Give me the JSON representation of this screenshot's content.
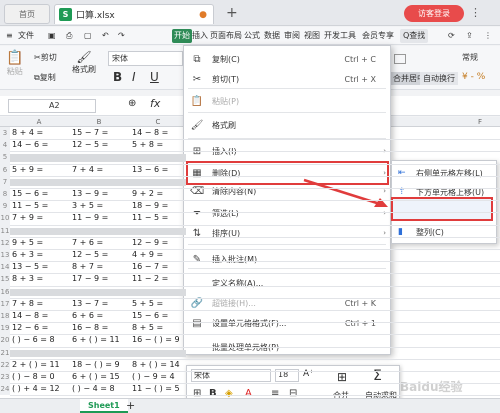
{
  "tabs": {
    "home": "首页",
    "file": "口算.xlsx",
    "file_badge": "S",
    "add": "+"
  },
  "login": "访客登录",
  "menu": {
    "file": "文件",
    "start": "开始",
    "items": [
      "插入",
      "页面布局",
      "公式",
      "数据",
      "审阅",
      "视图",
      "开发工具",
      "会员专享"
    ],
    "search": "Q查找"
  },
  "toolbar": {
    "cut": "剪切",
    "copy": "复制",
    "paste": "粘贴",
    "format_painter": "格式刷",
    "font": "宋体",
    "merge": "合并居中",
    "wrap": "自动换行",
    "normal": "常规"
  },
  "formula": {
    "namebox": "A2",
    "fx": "fx"
  },
  "columns": [
    "A",
    "B",
    "C",
    "F"
  ],
  "rows": [
    {
      "n": "3",
      "a": "8 + 4 =",
      "b": "15 − 7 =",
      "c": "14 − 8 ="
    },
    {
      "n": "4",
      "a": "14 − 6 =",
      "b": "12 − 5 =",
      "c": "5 + 8 ="
    },
    {
      "n": "5",
      "a": "",
      "b": "",
      "c": ""
    },
    {
      "n": "6",
      "a": "5 + 9 =",
      "b": "7 + 4 =",
      "c": "13 − 6 ="
    },
    {
      "n": "7",
      "a": "",
      "b": "",
      "c": ""
    },
    {
      "n": "8",
      "a": "15 − 6 =",
      "b": "13 − 9 =",
      "c": "9 + 2 ="
    },
    {
      "n": "9",
      "a": "11 − 5 =",
      "b": "3 + 5 =",
      "c": "18 − 9 ="
    },
    {
      "n": "10",
      "a": "7 + 9 =",
      "b": "11 − 9 =",
      "c": "11 − 5 ="
    },
    {
      "n": "11",
      "a": "",
      "b": "",
      "c": ""
    },
    {
      "n": "12",
      "a": "9 + 5 =",
      "b": "7 + 6 =",
      "c": "12 − 9 ="
    },
    {
      "n": "13",
      "a": "6 + 3 =",
      "b": "12 − 5 =",
      "c": "4 + 9 ="
    },
    {
      "n": "14",
      "a": "13 − 5 =",
      "b": "8 + 7 =",
      "c": "16 − 7 ="
    },
    {
      "n": "15",
      "a": "8 + 3 =",
      "b": "17 − 9 =",
      "c": "11 − 2 ="
    },
    {
      "n": "16",
      "a": "",
      "b": "",
      "c": ""
    },
    {
      "n": "17",
      "a": "7 + 8 =",
      "b": "13 − 7 =",
      "c": "5 + 5 ="
    },
    {
      "n": "18",
      "a": "14 − 8 =",
      "b": "6 + 6 =",
      "c": "15 − 6 ="
    },
    {
      "n": "19",
      "a": "12 − 6 =",
      "b": "16 − 8 =",
      "c": "8 + 5 ="
    },
    {
      "n": "20",
      "a": "(  ) − 6 = 8",
      "b": "6 + (  ) = 11",
      "c": "16 − (  ) = 9"
    },
    {
      "n": "21",
      "a": "",
      "b": "",
      "c": ""
    },
    {
      "n": "22",
      "a": "2 + (  ) = 11",
      "b": "18 − (  ) = 9",
      "c": "8 + (  ) = 14"
    },
    {
      "n": "23",
      "a": "(  ) − 8 = 0",
      "b": "6 + (  ) = 15",
      "c": "(  ) − 9 = 4"
    },
    {
      "n": "24",
      "a": "(  ) + 4 = 12",
      "b": "(  ) − 4 = 8",
      "c": "11 − (  ) = 5"
    }
  ],
  "context_menu": [
    {
      "icon": "copy-icon",
      "glyph": "⧉",
      "label": "复制(C)",
      "shortcut": "Ctrl + C"
    },
    {
      "icon": "cut-icon",
      "glyph": "✂",
      "label": "剪切(T)",
      "shortcut": "Ctrl + X"
    },
    {
      "icon": "paste-icon",
      "glyph": "📋",
      "label": "粘贴(P)",
      "shortcut": ""
    },
    {
      "icon": "format-painter-icon",
      "glyph": "🖌",
      "label": "格式刷",
      "shortcut": ""
    },
    {
      "icon": "insert-icon",
      "glyph": "⊞",
      "label": "插入(I)",
      "shortcut": ""
    },
    {
      "icon": "delete-icon",
      "glyph": "▦",
      "label": "删除(D)",
      "shortcut": ""
    },
    {
      "icon": "clear-icon",
      "glyph": "⌫",
      "label": "清除内容(N)",
      "shortcut": ""
    },
    {
      "icon": "filter-icon",
      "glyph": "⏷",
      "label": "筛选(L)",
      "shortcut": ""
    },
    {
      "icon": "sort-icon",
      "glyph": "⇅",
      "label": "排序(U)",
      "shortcut": ""
    },
    {
      "icon": "comment-icon",
      "glyph": "✎",
      "label": "插入批注(M)",
      "shortcut": ""
    },
    {
      "icon": "name-icon",
      "glyph": "",
      "label": "定义名称(A)...",
      "shortcut": ""
    },
    {
      "icon": "hyperlink-icon",
      "glyph": "🔗",
      "label": "超链接(H)...",
      "shortcut": "Ctrl + K"
    },
    {
      "icon": "cell-format-icon",
      "glyph": "▤",
      "label": "设置单元格格式(F)...",
      "shortcut": "Ctrl + 1"
    },
    {
      "icon": "batch-icon",
      "glyph": "",
      "label": "批量处理单元格(P)",
      "shortcut": ""
    }
  ],
  "submenu": [
    {
      "label": "右侧单元格左移(L)"
    },
    {
      "label": "下方单元格上移(U)"
    },
    {
      "label": "整行(R)"
    },
    {
      "label": "整列(C)"
    }
  ],
  "minibar": {
    "font": "宋体",
    "size": "18",
    "merge": "合并",
    "autosum": "自动求和"
  },
  "sheet_tab": "Sheet1",
  "watermark": "Baidu经验",
  "colors": {
    "accent": "#1e9a55",
    "highlight": "#e03c3c",
    "login": "#e84b4b"
  }
}
